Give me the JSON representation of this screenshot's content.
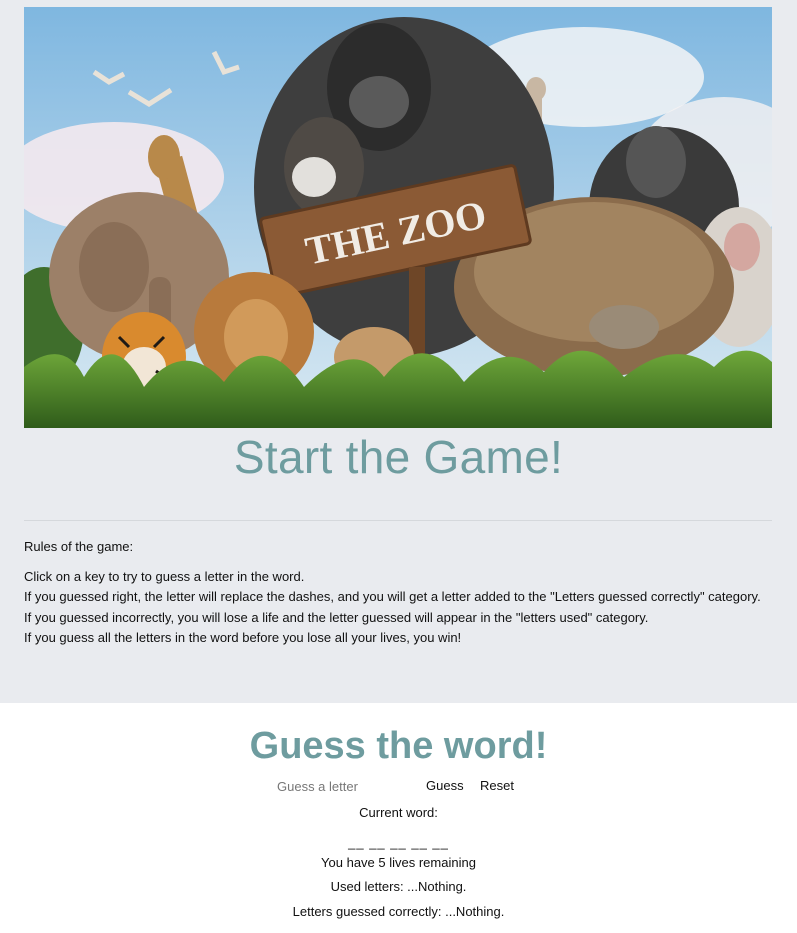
{
  "hero": {
    "sign_text": "THE ZOO",
    "colors": {
      "sky": "#8fc2e6",
      "grass": "#4d8a2a",
      "accent": "#6e9c9f"
    }
  },
  "intro": {
    "title": "Start the Game!",
    "rules_heading": "Rules of the game:",
    "rules": [
      "Click on a key to try to guess a letter in the word.",
      "If you guessed right, the letter will replace the dashes, and you will get a letter added to the \"Letters guessed correctly\" category.",
      "If you guessed incorrectly, you will lose a life and the letter guessed will appear in the \"letters used\" category.",
      "If you guess all the letters in the word before you lose all your lives, you win!"
    ]
  },
  "game": {
    "title": "Guess the word!",
    "input_placeholder": "Guess a letter",
    "input_value": "",
    "guess_label": "Guess",
    "reset_label": "Reset",
    "current_word_label": "Current word:",
    "word_display": "__ __ __ __ __",
    "lives_text": "You have 5 lives remaining",
    "used_letters_text": "Used letters: ...Nothing.",
    "correct_letters_text": "Letters guessed correctly: ...Nothing."
  }
}
